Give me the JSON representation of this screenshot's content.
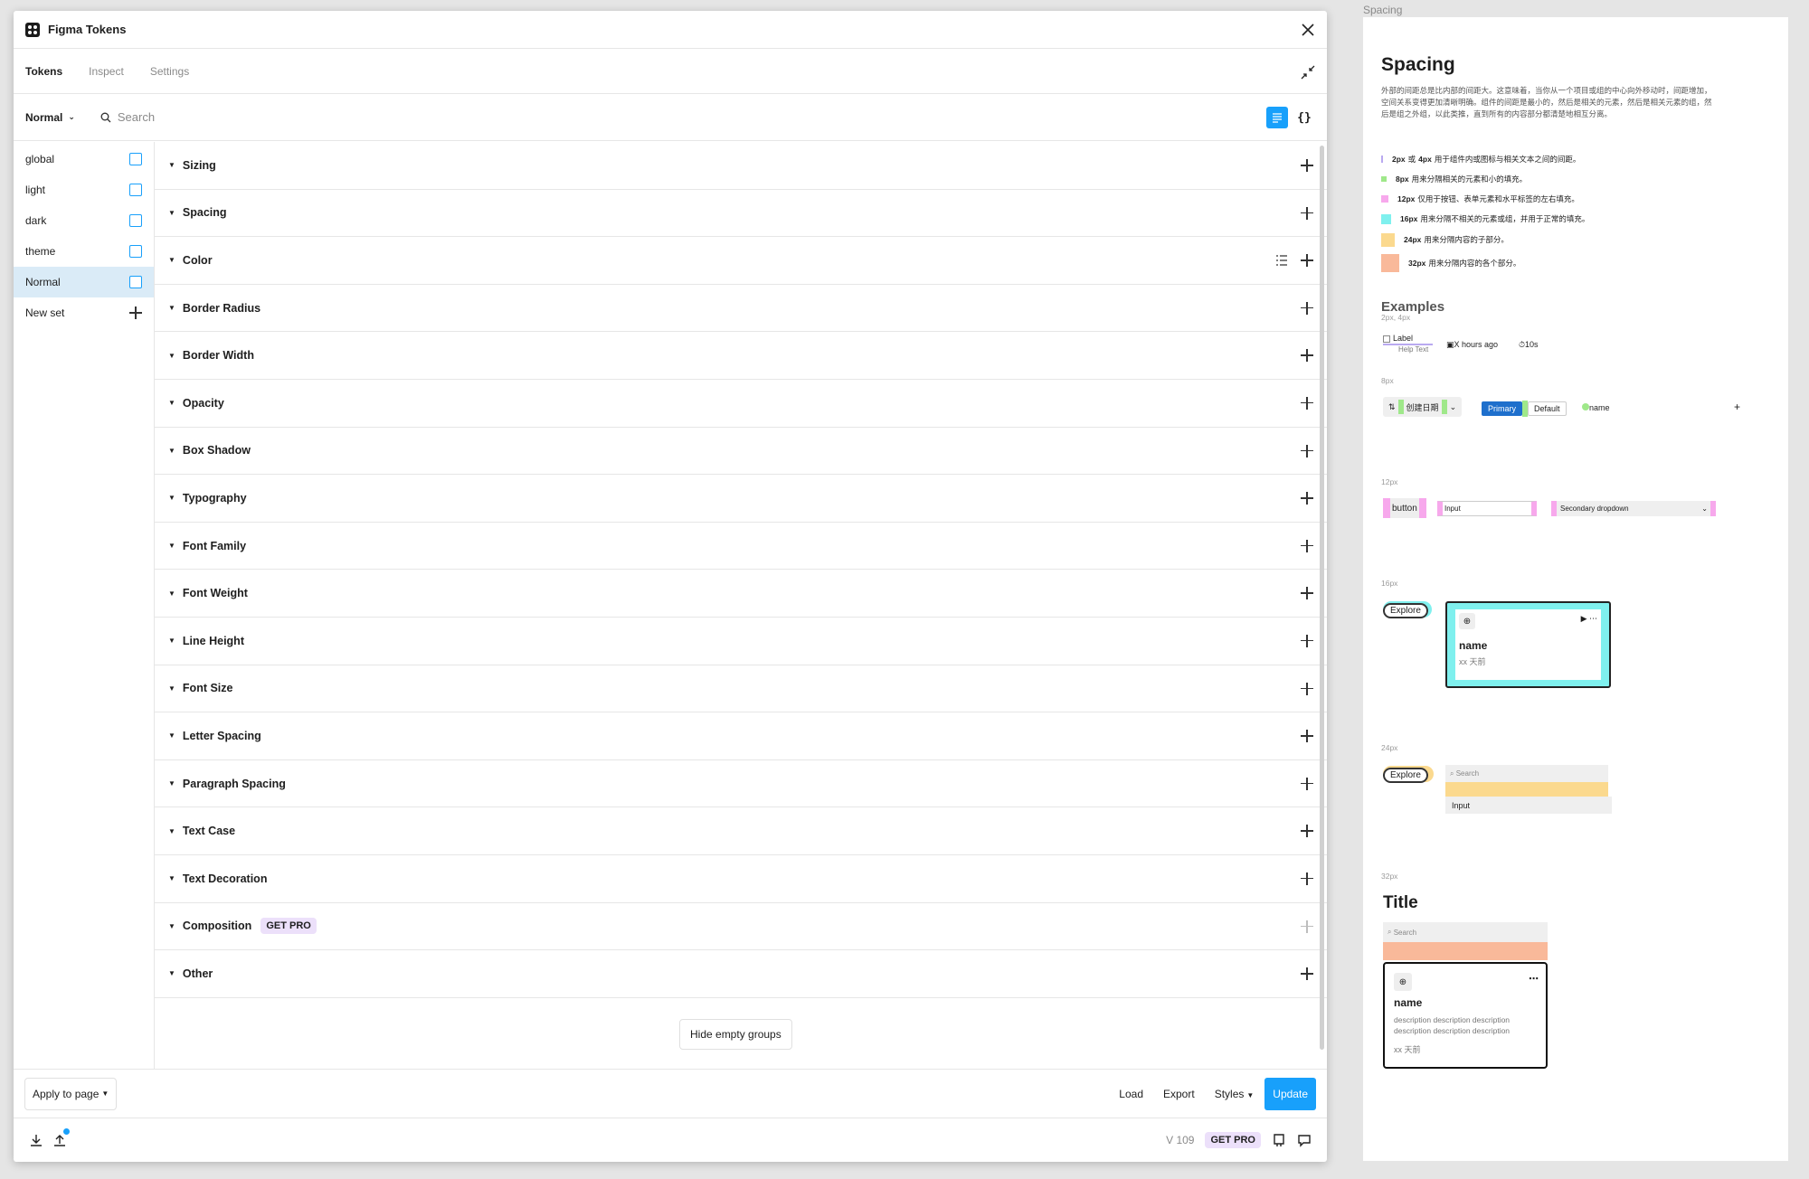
{
  "window": {
    "title": "Figma Tokens"
  },
  "tabs": [
    "Tokens",
    "Inspect",
    "Settings"
  ],
  "toolbar": {
    "mode": "Normal",
    "search_placeholder": "Search"
  },
  "sets": [
    {
      "label": "global",
      "active": false
    },
    {
      "label": "light",
      "active": false
    },
    {
      "label": "dark",
      "active": false
    },
    {
      "label": "theme",
      "active": false
    },
    {
      "label": "Normal",
      "active": true
    }
  ],
  "new_set_label": "New set",
  "groups": [
    "Sizing",
    "Spacing",
    "Color",
    "Border Radius",
    "Border Width",
    "Opacity",
    "Box Shadow",
    "Typography",
    "Font Family",
    "Font Weight",
    "Line Height",
    "Font Size",
    "Letter Spacing",
    "Paragraph Spacing",
    "Text Case",
    "Text Decoration",
    "Composition",
    "Other"
  ],
  "composition_badge": "GET PRO",
  "hide_empty_label": "Hide empty groups",
  "actions": {
    "apply": "Apply to page",
    "load": "Load",
    "export": "Export",
    "styles": "Styles",
    "update": "Update"
  },
  "footer": {
    "version": "V 109",
    "pro": "GET PRO"
  },
  "frame": {
    "label": "Spacing",
    "title": "Spacing",
    "description": "外部的间距总是比内部的间距大。这意味着，当你从一个项目或组的中心向外移动时，间距增加，空间关系变得更加清晰明确。组件的间距是最小的，然后是相关的元素，然后是相关元素的组，然后是组之外组，以此类推，直到所有的内容部分都清楚地相互分离。",
    "legend": [
      {
        "size": "2px",
        "or": "或",
        "size2": "4px",
        "text": "用于组件内或图标与相关文本之间的间距。",
        "color": "#b9a9f0"
      },
      {
        "size": "8px",
        "text": "用来分隔相关的元素和小的填充。",
        "color": "#9fe88a"
      },
      {
        "size": "12px",
        "text": "仅用于按钮、表单元素和水平标签的左右填充。",
        "color": "#f7a8ec"
      },
      {
        "size": "16px",
        "text": "用来分隔不相关的元素或组，并用于正常的填充。",
        "color": "#7ff0ee"
      },
      {
        "size": "24px",
        "text": "用来分隔内容的子部分。",
        "color": "#fbd98e"
      },
      {
        "size": "32px",
        "text": "用来分隔内容的各个部分。",
        "color": "#f9b99a"
      }
    ],
    "examples_title": "Examples",
    "ex1": {
      "label": "2px, 4px",
      "cb": "Label",
      "help": "Help Text",
      "time": "X  hours ago",
      "timer": "10s"
    },
    "ex2": {
      "label": "8px",
      "date": "创建日期",
      "primary": "Primary",
      "default": "Default",
      "name": "name"
    },
    "ex3": {
      "label": "12px",
      "button": "button",
      "input": "Input",
      "dropdown": "Secondary dropdown"
    },
    "ex4": {
      "label": "16px",
      "explore": "Explore",
      "name": "name",
      "time": "xx 天前"
    },
    "ex5": {
      "label": "24px",
      "explore": "Explore",
      "search": "Search",
      "input": "Input"
    },
    "ex6": {
      "label": "32px",
      "title": "Title",
      "search": "Search",
      "name": "name",
      "desc": "description description description description description description",
      "time": "xx 天前"
    }
  }
}
